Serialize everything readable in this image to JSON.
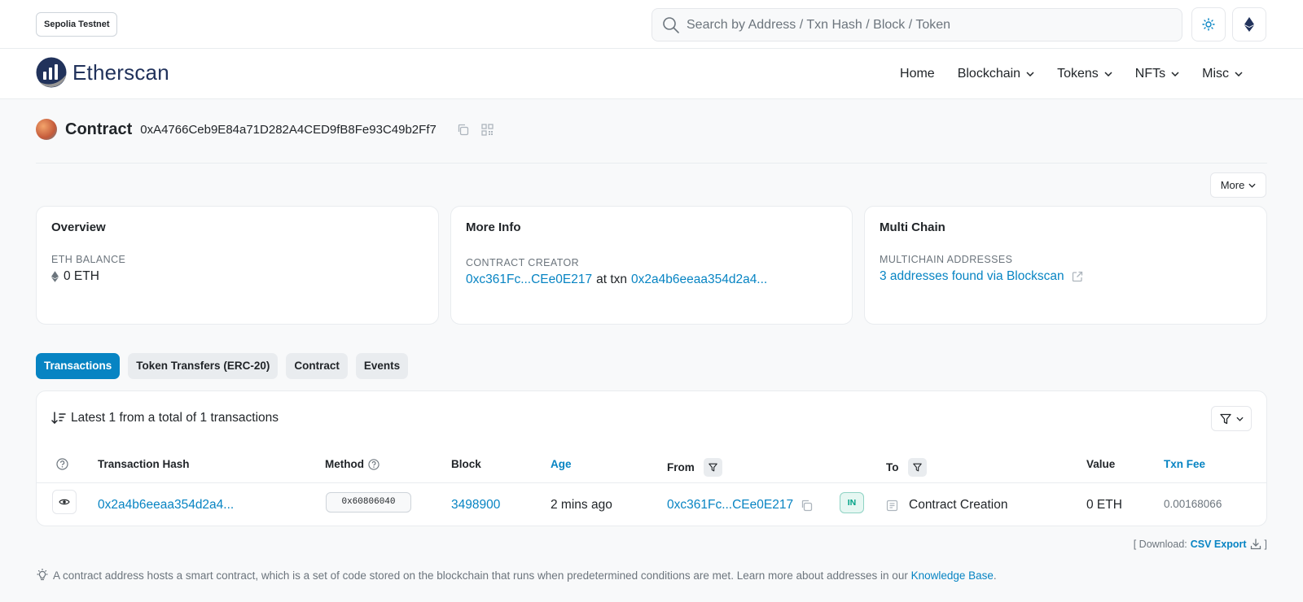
{
  "topbar": {
    "network": "Sepolia Testnet",
    "search_placeholder": "Search by Address / Txn Hash / Block / Token"
  },
  "nav": {
    "logo": "Etherscan",
    "items": [
      "Home",
      "Blockchain",
      "Tokens",
      "NFTs",
      "Misc"
    ]
  },
  "contract": {
    "title": "Contract",
    "address": "0xA4766Ceb9E84a71D282A4CED9fB8Fe93C49b2Ff7",
    "more_label": "More"
  },
  "cards": {
    "overview": {
      "title": "Overview",
      "label": "ETH BALANCE",
      "value": "0 ETH"
    },
    "more_info": {
      "title": "More Info",
      "label": "CONTRACT CREATOR",
      "creator": "0xc361Fc...CEe0E217",
      "at_txn": "at txn",
      "txn": "0x2a4b6eeaa354d2a4..."
    },
    "multi_chain": {
      "title": "Multi Chain",
      "label": "MULTICHAIN ADDRESSES",
      "value": "3 addresses found via Blockscan"
    }
  },
  "tabs": [
    "Transactions",
    "Token Transfers (ERC-20)",
    "Contract",
    "Events"
  ],
  "table": {
    "summary": "Latest 1 from a total of 1 transactions",
    "headers": {
      "hash": "Transaction Hash",
      "method": "Method",
      "block": "Block",
      "age": "Age",
      "from": "From",
      "to": "To",
      "value": "Value",
      "fee": "Txn Fee"
    },
    "row": {
      "hash": "0x2a4b6eeaa354d2a4...",
      "method": "0x60806040",
      "block": "3498900",
      "age": "2 mins ago",
      "from": "0xc361Fc...CEe0E217",
      "direction": "IN",
      "to": "Contract Creation",
      "value": "0 ETH",
      "fee": "0.00168066"
    }
  },
  "footer": {
    "download_prefix": "[ Download:",
    "download_link": "CSV Export",
    "download_suffix": "]",
    "note": "A contract address hosts a smart contract, which is a set of code stored on the blockchain that runs when predetermined conditions are met. Learn more about addresses in our",
    "note_link": "Knowledge Base",
    "note_end": "."
  },
  "colors": {
    "accent": "#0784c3",
    "brand_dark": "#21325b",
    "in_badge": "#00a186"
  }
}
